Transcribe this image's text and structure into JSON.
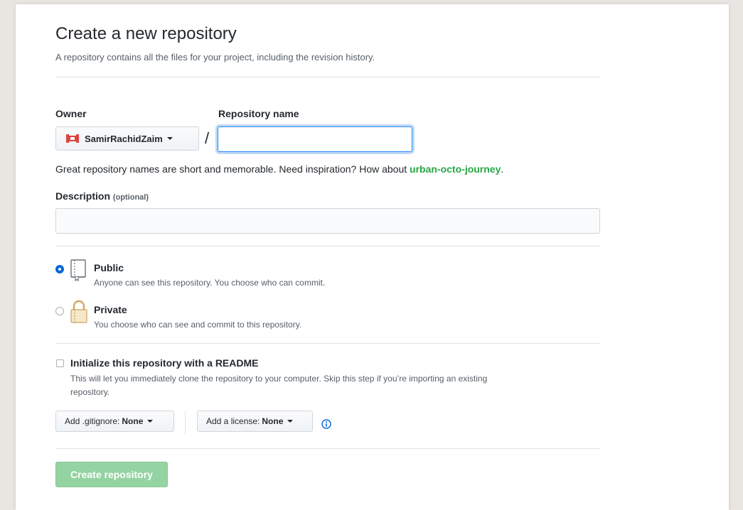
{
  "header": {
    "title": "Create a new repository",
    "subtitle": "A repository contains all the files for your project, including the revision history."
  },
  "owner": {
    "label": "Owner",
    "value": "SamirRachidZaim"
  },
  "separator": "/",
  "repo_name": {
    "label": "Repository name",
    "value": "",
    "placeholder": ""
  },
  "name_hint": {
    "text": "Great repository names are short and memorable. Need inspiration? How about ",
    "suggestion": "urban-octo-journey",
    "suffix": "."
  },
  "description": {
    "label": "Description",
    "optional": "(optional)",
    "value": ""
  },
  "visibility": {
    "public": {
      "title": "Public",
      "desc": "Anyone can see this repository. You choose who can commit.",
      "selected": true
    },
    "private": {
      "title": "Private",
      "desc": "You choose who can see and commit to this repository.",
      "selected": false
    }
  },
  "readme": {
    "title": "Initialize this repository with a README",
    "desc_line1": "This will let you immediately clone the repository to your computer. Skip this step if you’re importing an existing",
    "desc_line2": "repository.",
    "checked": false
  },
  "gitignore": {
    "label": "Add .gitignore:",
    "value": "None"
  },
  "license": {
    "label": "Add a license:",
    "value": "None"
  },
  "submit": {
    "label": "Create repository"
  },
  "colors": {
    "accent_blue": "#0366d6",
    "suggestion_green": "#28a745",
    "disabled_button_green": "#94d3a2"
  }
}
